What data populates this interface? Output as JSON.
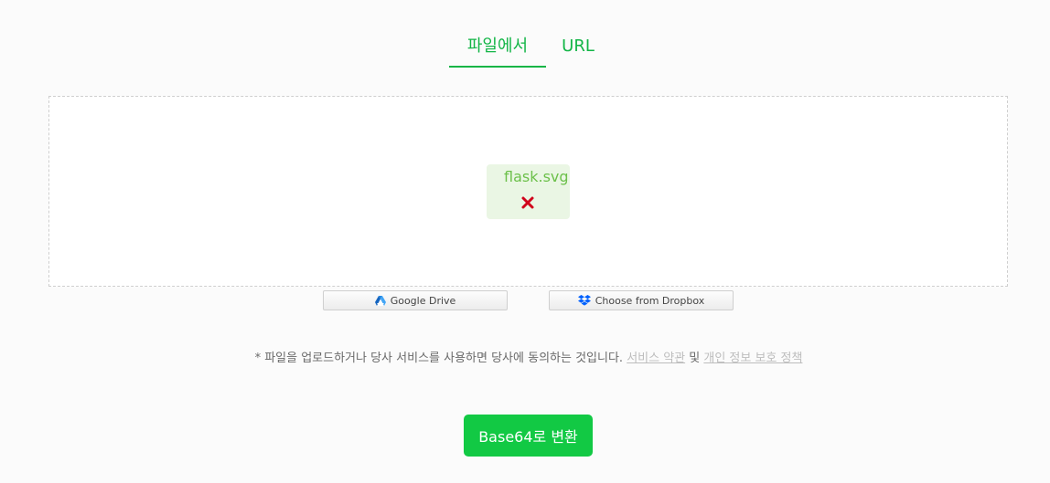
{
  "tabs": {
    "file_label": "파일에서",
    "url_label": "URL",
    "active": "file"
  },
  "dropzone": {
    "file": {
      "name": "flask.svg",
      "remove_icon": "close-icon"
    }
  },
  "cloud_buttons": {
    "google_drive": {
      "label": "Google Drive",
      "icon": "google-drive-icon"
    },
    "dropbox": {
      "label": "Choose from Dropbox",
      "icon": "dropbox-icon"
    }
  },
  "terms": {
    "prefix": "* 파일을 업로드하거나 당사 서비스를 사용하면 당사에 동의하는 것입니다. ",
    "tos_link": "서비스 약관",
    "conjunction": " 및 ",
    "privacy_link": "개인 정보 보호 정책"
  },
  "convert_button": {
    "label": "Base64로 변환"
  },
  "below_fold_text": "",
  "colors": {
    "accent": "#12b546",
    "button": "#12c944",
    "file_card_bg": "#eaf6e4",
    "file_name": "#6cc04a",
    "remove_icon": "#d0021b"
  }
}
